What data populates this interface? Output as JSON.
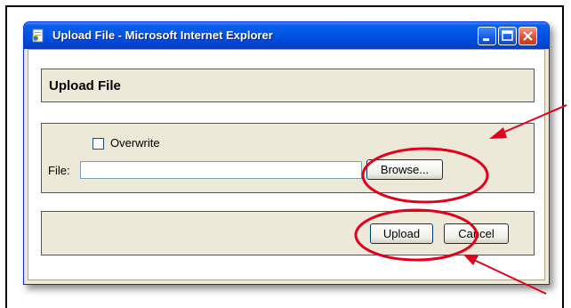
{
  "window": {
    "title": "Upload File - Microsoft Internet Explorer",
    "icon": "ie-page-icon"
  },
  "header": {
    "title": "Upload File"
  },
  "form": {
    "overwrite_label": "Overwrite",
    "overwrite_checked": false,
    "file_label": "File:",
    "file_value": "",
    "browse_label": "Browse..."
  },
  "footer": {
    "upload_label": "Upload",
    "cancel_label": "Cancel"
  },
  "annotations": {
    "highlight_color": "#e3001b",
    "arrow_color": "#e3001b"
  },
  "colors": {
    "titlebar": "#0055e5",
    "panel_bg": "#ece9d8",
    "close_button": "#e2502f"
  }
}
